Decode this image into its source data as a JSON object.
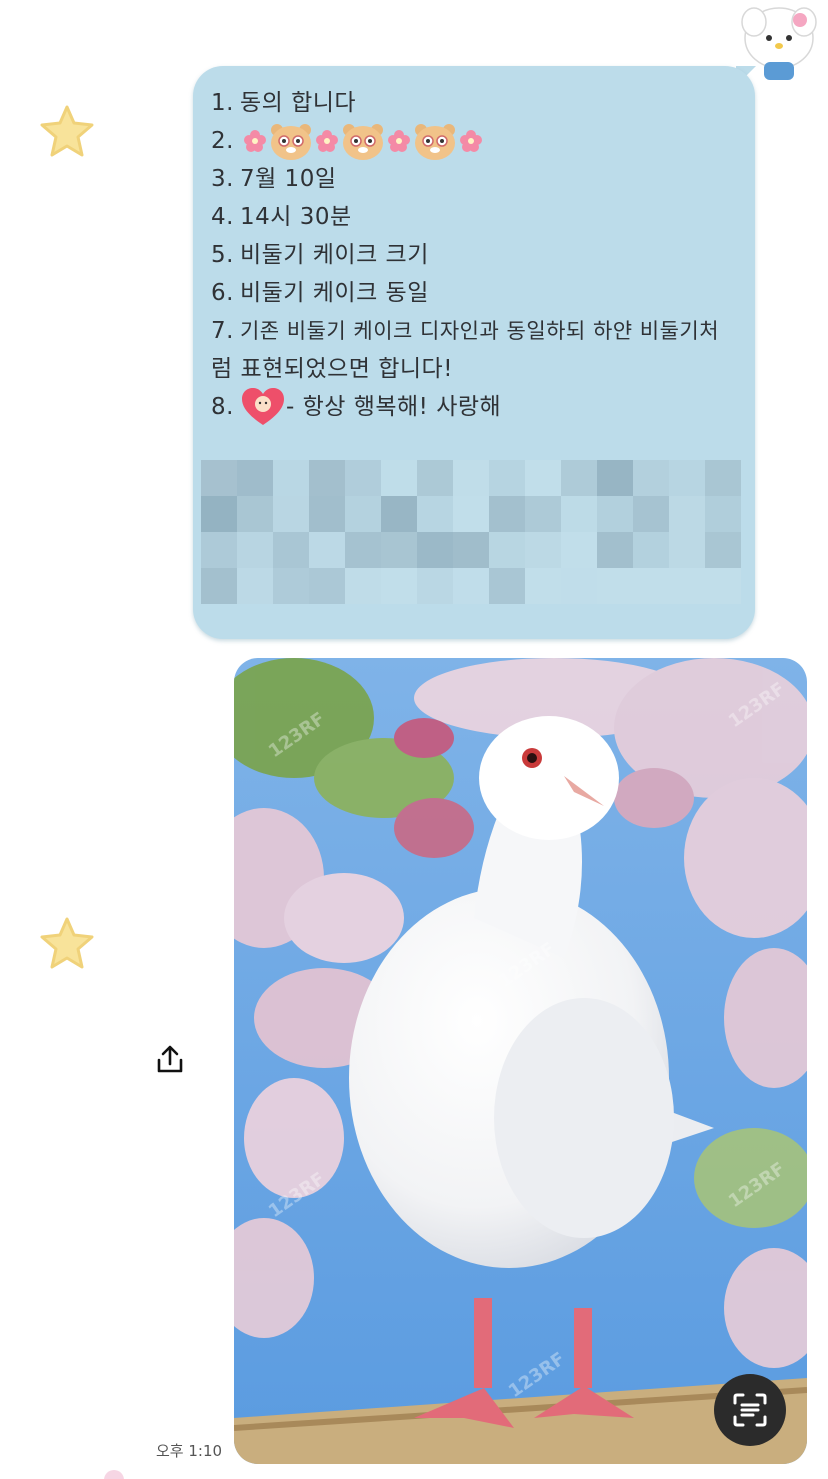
{
  "message": {
    "lines": [
      {
        "num": "1.",
        "text": "동의 합니다"
      },
      {
        "num": "2.",
        "text": ""
      },
      {
        "num": "3.",
        "text": "7월 10일"
      },
      {
        "num": "4.",
        "text": "14시 30분"
      },
      {
        "num": "5.",
        "text": "비둘기 케이크 크기"
      },
      {
        "num": "6.",
        "text": "비둘기 케이크 동일"
      },
      {
        "num": "7.",
        "text": "기존 비둘기 케이크 디자인과 동일하되 하얀 비둘기처"
      },
      {
        "num": "",
        "text": "럼 표현되었으면 합니다!"
      },
      {
        "num": "8.",
        "text": "- 항상 행복해! 사랑해"
      }
    ],
    "emojis": [
      "flower-icon",
      "bear-icon",
      "flower-icon",
      "bear-icon",
      "flower-icon",
      "bear-icon",
      "flower-icon"
    ],
    "heart_emoji": "heart-baby-icon",
    "bubble_color": "#bcdcea"
  },
  "photo": {
    "watermark": "123RF",
    "subject": "white-pigeon"
  },
  "timestamp": "오후 1:10",
  "icons": {
    "share": "share-icon",
    "scan": "text-scan-icon",
    "star": "star-icon",
    "sticker": "kitty-sticker-icon"
  }
}
